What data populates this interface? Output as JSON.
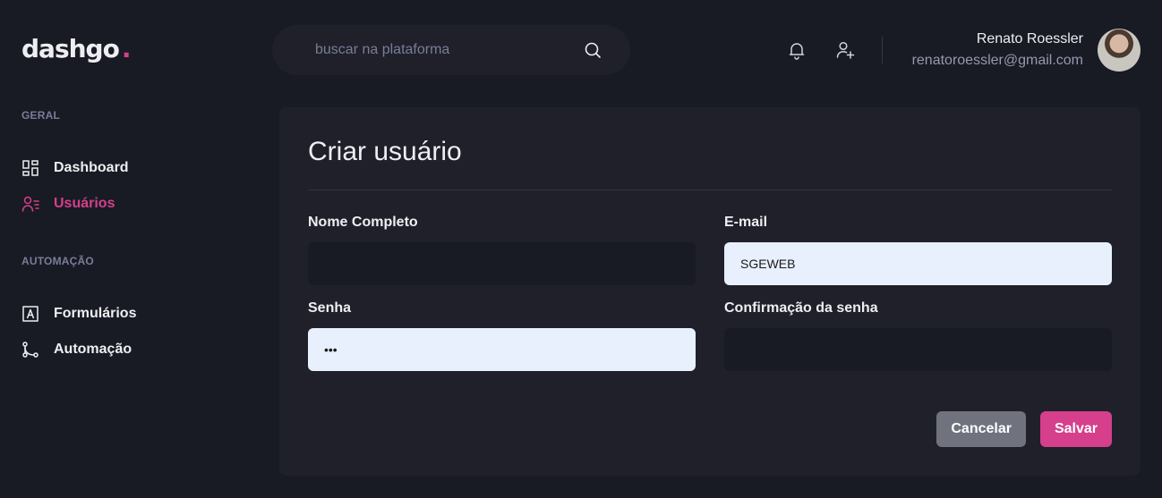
{
  "brand": {
    "name": "dashgo",
    "dot": ".",
    "accent": "#D53F8C"
  },
  "search": {
    "placeholder": "buscar na plataforma",
    "icon": "search-icon"
  },
  "header": {
    "icons": [
      "bell-icon",
      "user-add-icon"
    ]
  },
  "profile": {
    "name": "Renato Roessler",
    "email": "renatoroessler@gmail.com"
  },
  "sidebar": {
    "sections": [
      {
        "title": "GERAL",
        "items": [
          {
            "label": "Dashboard",
            "icon": "dashboard-icon",
            "active": false
          },
          {
            "label": "Usuários",
            "icon": "users-icon",
            "active": true
          }
        ]
      },
      {
        "title": "AUTOMAÇÃO",
        "items": [
          {
            "label": "Formulários",
            "icon": "forms-icon",
            "active": false
          },
          {
            "label": "Automação",
            "icon": "git-merge-icon",
            "active": false
          }
        ]
      }
    ]
  },
  "form": {
    "title": "Criar usuário",
    "fields": {
      "name": {
        "label": "Nome Completo",
        "value": ""
      },
      "email": {
        "label": "E-mail",
        "value": "SGEWEB"
      },
      "password": {
        "label": "Senha",
        "value": "abc"
      },
      "password_confirm": {
        "label": "Confirmação da senha",
        "value": ""
      }
    },
    "cancel_label": "Cancelar",
    "save_label": "Salvar"
  }
}
